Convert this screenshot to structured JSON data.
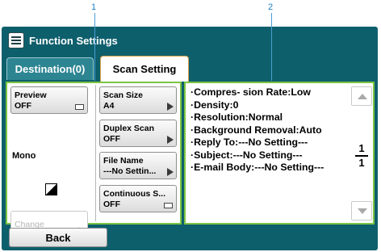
{
  "callouts": [
    "1",
    "2"
  ],
  "header": {
    "title": "Function Settings",
    "icon": "menu-list-icon"
  },
  "tabs": [
    {
      "label": "Destination(0)",
      "selected": false
    },
    {
      "label": "Scan Setting",
      "selected": true
    }
  ],
  "left_panel": {
    "preview": {
      "label": "Preview",
      "value": "OFF"
    },
    "mono_label": "Mono",
    "change": {
      "label": "Change",
      "enabled": false
    },
    "scan_size": {
      "label": "Scan Size",
      "value": "A4"
    },
    "duplex_scan": {
      "label": "Duplex Scan",
      "value": "OFF"
    },
    "file_name": {
      "label": "File Name",
      "value": "---No Settin..."
    },
    "continuous_scan": {
      "label": "Continuous S...",
      "value": "OFF"
    }
  },
  "info_list": [
    "·Compres- sion Rate:Low",
    "·Density:0",
    "·Resolution:Normal",
    "·Background Removal:Auto",
    "·Reply To:---No Setting---",
    "·Subject:---No Setting---",
    "·E-mail Body:---No Setting---"
  ],
  "pager": {
    "current": "1",
    "total": "1"
  },
  "footer": {
    "back_label": "Back"
  },
  "colors": {
    "frame": "#0e5f6c",
    "panel_border": "#7cc443",
    "tab_border": "#d9a24a",
    "callout": "#1b7fc4"
  }
}
